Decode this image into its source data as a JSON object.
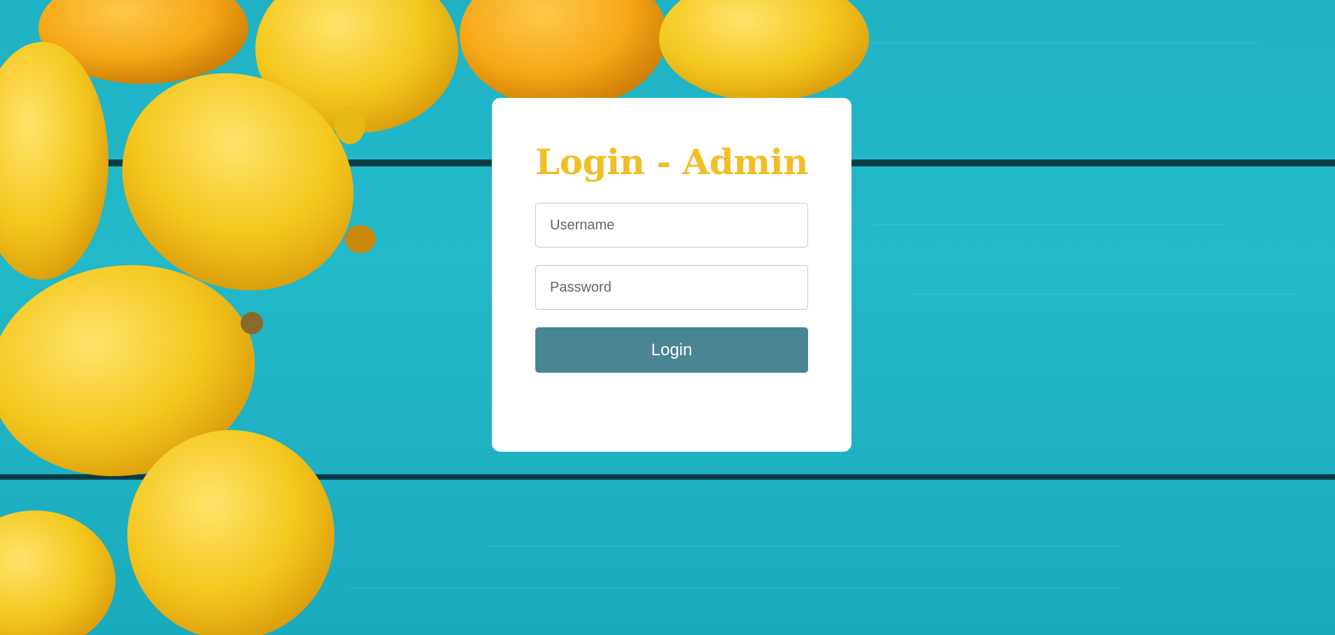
{
  "login": {
    "title": "Login - Admin",
    "username_placeholder": "Username",
    "username_value": "",
    "password_placeholder": "Password",
    "password_value": "",
    "button_label": "Login"
  },
  "colors": {
    "title": "#f1bf25",
    "button": "#4a8592",
    "background": "#22b9c9",
    "lemon": "#f5c81f"
  },
  "background": {
    "depiction": "lemons on turquoise wooden planks"
  }
}
